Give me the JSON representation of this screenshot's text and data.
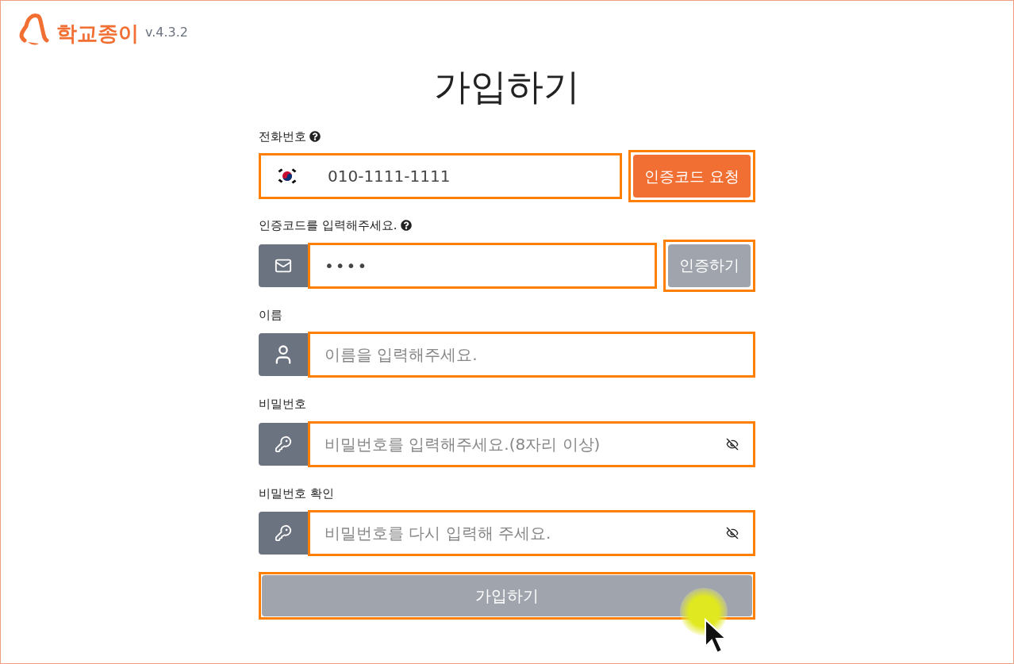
{
  "logo": {
    "name": "학교종이",
    "version": "v.4.3.2"
  },
  "title": "가입하기",
  "fields": [
    {
      "kind": "phone",
      "label": "전화번호",
      "help": true,
      "value": "010-1111-1111",
      "button": {
        "label": "인증코드 요청",
        "disabled": false
      }
    },
    {
      "kind": "code",
      "label": "인증코드를 입력해주세요.",
      "help": true,
      "value": "••••",
      "button": {
        "label": "인증하기",
        "disabled": true
      }
    },
    {
      "kind": "name",
      "label": "이름",
      "help": false,
      "placeholder": "이름을 입력해주세요."
    },
    {
      "kind": "password",
      "label": "비밀번호",
      "help": false,
      "placeholder": "비밀번호를 입력해주세요.(8자리 이상)"
    },
    {
      "kind": "password",
      "label": "비밀번호 확인",
      "help": false,
      "placeholder": "비밀번호를 다시 입력해 주세요."
    }
  ],
  "submit": {
    "label": "가입하기",
    "disabled": true
  }
}
